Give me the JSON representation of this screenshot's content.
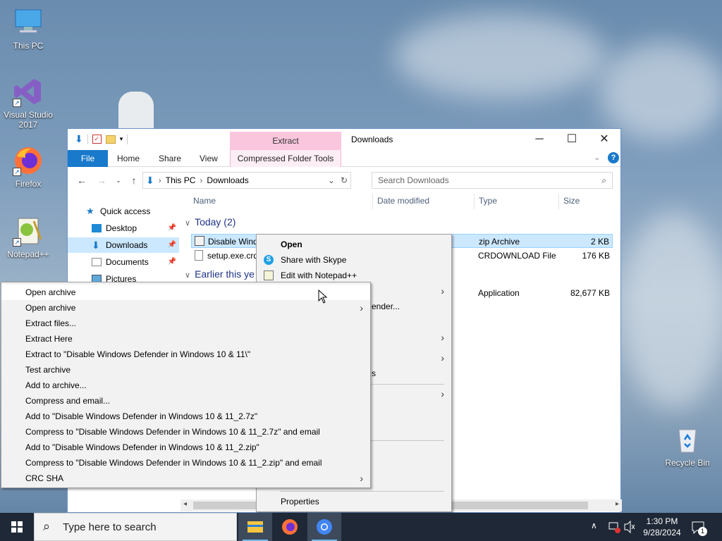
{
  "desktop": {
    "icons": [
      {
        "label": "This PC"
      },
      {
        "label": "Visual Studio 2017"
      },
      {
        "label": "Firefox"
      },
      {
        "label": "Notepad++"
      },
      {
        "label": "Recycle Bin"
      }
    ]
  },
  "explorer": {
    "title": "Downloads",
    "contextual_tab_group": "Extract",
    "tabs": {
      "file": "File",
      "home": "Home",
      "share": "Share",
      "view": "View",
      "tools": "Compressed Folder Tools"
    },
    "path": {
      "root": "This PC",
      "folder": "Downloads"
    },
    "search_placeholder": "Search Downloads",
    "nav": [
      {
        "label": "Quick access"
      },
      {
        "label": "Desktop"
      },
      {
        "label": "Downloads"
      },
      {
        "label": "Documents"
      },
      {
        "label": "Pictures"
      }
    ],
    "columns": {
      "name": "Name",
      "date": "Date modified",
      "type": "Type",
      "size": "Size"
    },
    "groups": {
      "today": "Today (2)",
      "earlier": "Earlier this ye"
    },
    "files": [
      {
        "name": "Disable Wind",
        "type": "zip Archive",
        "size": "2 KB"
      },
      {
        "name": "setup.exe.crd",
        "type": "CRDOWNLOAD File",
        "size": "176 KB"
      },
      {
        "name": "",
        "type": "Application",
        "size": "82,677 KB"
      }
    ]
  },
  "shell_menu": {
    "open": "Open",
    "share_skype": "Share with Skype",
    "edit_notepad": "Edit with Notepad++",
    "defender_partial": "ender...",
    "partial_s": "s",
    "properties": "Properties"
  },
  "zip_menu": {
    "items": [
      {
        "label": "Open archive"
      },
      {
        "label": "Open archive"
      },
      {
        "label": "Extract files..."
      },
      {
        "label": "Extract Here"
      },
      {
        "label": "Extract to \"Disable Windows Defender in Windows 10 & 11\\\""
      },
      {
        "label": "Test archive"
      },
      {
        "label": "Add to archive..."
      },
      {
        "label": "Compress and email..."
      },
      {
        "label": "Add to \"Disable Windows Defender in Windows 10 & 11_2.7z\""
      },
      {
        "label": "Compress to \"Disable Windows Defender in Windows 10 & 11_2.7z\" and email"
      },
      {
        "label": "Add to \"Disable Windows Defender in Windows 10 & 11_2.zip\""
      },
      {
        "label": "Compress to \"Disable Windows Defender in Windows 10 & 11_2.zip\" and email"
      },
      {
        "label": "CRC SHA"
      }
    ]
  },
  "taskbar": {
    "search_placeholder": "Type here to search",
    "time": "1:30 PM",
    "date": "9/28/2024",
    "notification_count": "1"
  },
  "colors": {
    "accent": "#1979ca",
    "selection": "#cce8ff",
    "context_tab": "#f9c6dd",
    "taskbar": "#1f2836"
  }
}
